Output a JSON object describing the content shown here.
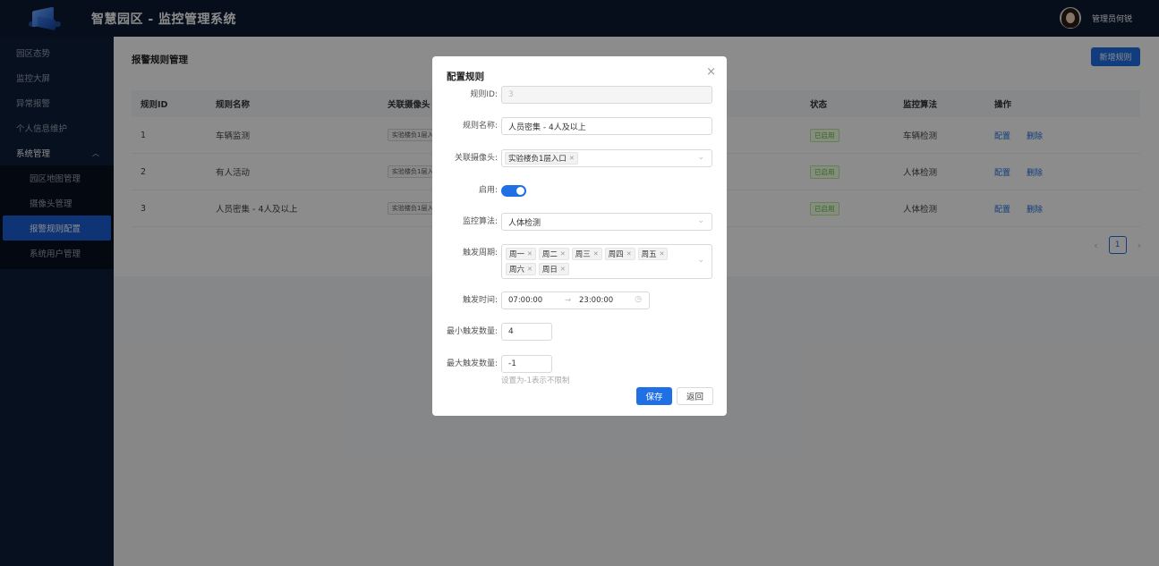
{
  "header": {
    "app_title": "智慧园区 - 监控管理系统",
    "username": "管理员何锐"
  },
  "sidebar": {
    "items": [
      {
        "label": "园区态势"
      },
      {
        "label": "监控大屏"
      },
      {
        "label": "异常报警"
      },
      {
        "label": "个人信息维护"
      },
      {
        "label": "系统管理",
        "expanded": true
      }
    ],
    "submenu": [
      {
        "label": "园区地图管理"
      },
      {
        "label": "摄像头管理"
      },
      {
        "label": "报警规则配置",
        "active": true
      },
      {
        "label": "系统用户管理"
      }
    ]
  },
  "page": {
    "title": "报警规则管理",
    "add_button": "新增规则"
  },
  "table": {
    "headers": [
      "规则ID",
      "规则名称",
      "关联摄像头",
      "状态",
      "监控算法",
      "操作"
    ],
    "rows": [
      {
        "id": "1",
        "name": "车辆监测",
        "camera": "实验楼负1层入口",
        "status": "已启用",
        "algorithm": "车辆检测",
        "op_config": "配置",
        "op_delete": "删除"
      },
      {
        "id": "2",
        "name": "有人活动",
        "camera": "实验楼负1层入口",
        "status": "已启用",
        "algorithm": "人体检测",
        "op_config": "配置",
        "op_delete": "删除"
      },
      {
        "id": "3",
        "name": "人员密集 - 4人及以上",
        "camera": "实验楼负1层入口",
        "status": "已启用",
        "algorithm": "人体检测",
        "op_config": "配置",
        "op_delete": "删除"
      }
    ]
  },
  "pagination": {
    "prev": "‹",
    "current": "1",
    "next": "›"
  },
  "modal": {
    "title": "配置规则",
    "close": "×",
    "fields": {
      "rule_id": {
        "label": "规则ID:",
        "value": "3"
      },
      "rule_name": {
        "label": "规则名称:",
        "value": "人员密集 - 4人及以上"
      },
      "camera": {
        "label": "关联摄像头:",
        "tags": [
          "实验楼负1层入口"
        ]
      },
      "enabled": {
        "label": "启用:",
        "on": true
      },
      "algorithm": {
        "label": "监控算法:",
        "value": "人体检测"
      },
      "period": {
        "label": "触发周期:",
        "tags": [
          "周一",
          "周二",
          "周三",
          "周四",
          "周五",
          "周六",
          "周日"
        ]
      },
      "time": {
        "label": "触发时间:",
        "start": "07:00:00",
        "separator": "→",
        "end": "23:00:00"
      },
      "min_count": {
        "label": "最小触发数量:",
        "value": "4"
      },
      "max_count": {
        "label": "最大触发数量:",
        "value": "-1",
        "hint": "设置为-1表示不限制"
      }
    },
    "save_label": "保存",
    "back_label": "返回"
  },
  "colors": {
    "header_bg": "#0b1b33",
    "sidebar_bg": "#0d1e38",
    "accent": "#1f6fe5",
    "status_green": "#52c41a"
  },
  "icons": {
    "logo": "building-logo-icon",
    "close": "close-icon",
    "dropdown": "chevron-down-icon",
    "clock": "clock-icon"
  }
}
